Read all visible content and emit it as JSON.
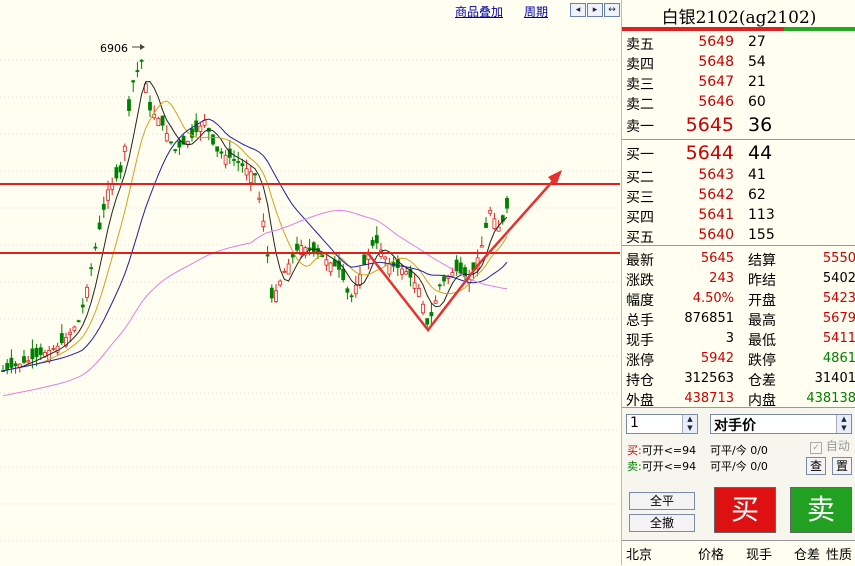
{
  "toolbar": {
    "overlay_label": "商品叠加",
    "period_label": "周期"
  },
  "chart": {
    "peak_label": "6906",
    "colors": {
      "hline": "#e02020",
      "arrow": "#e83030",
      "ma5": "#222",
      "ma10": "#d4a020",
      "ma20": "#2020a0",
      "ma60": "#e080e0",
      "up": "#e02020",
      "down": "#008000"
    }
  },
  "quote": {
    "title": "白银2102(ag2102)",
    "asks": [
      {
        "label": "卖五",
        "price": "5649",
        "vol": "27"
      },
      {
        "label": "卖四",
        "price": "5648",
        "vol": "54"
      },
      {
        "label": "卖三",
        "price": "5647",
        "vol": "21"
      },
      {
        "label": "卖二",
        "price": "5646",
        "vol": "60"
      },
      {
        "label": "卖一",
        "price": "5645",
        "vol": "36"
      }
    ],
    "bids": [
      {
        "label": "买一",
        "price": "5644",
        "vol": "44"
      },
      {
        "label": "买二",
        "price": "5643",
        "vol": "41"
      },
      {
        "label": "买三",
        "price": "5642",
        "vol": "62"
      },
      {
        "label": "买四",
        "price": "5641",
        "vol": "113"
      },
      {
        "label": "买五",
        "price": "5640",
        "vol": "155"
      }
    ],
    "stats": [
      {
        "l1": "最新",
        "v1": "5645",
        "c1": "red",
        "l2": "结算",
        "v2": "5550",
        "c2": "red"
      },
      {
        "l1": "涨跌",
        "v1": "243",
        "c1": "red",
        "l2": "昨结",
        "v2": "5402",
        "c2": "black"
      },
      {
        "l1": "幅度",
        "v1": "4.50%",
        "c1": "red",
        "l2": "开盘",
        "v2": "5423",
        "c2": "red"
      },
      {
        "l1": "总手",
        "v1": "876851",
        "c1": "black",
        "l2": "最高",
        "v2": "5679",
        "c2": "red"
      },
      {
        "l1": "现手",
        "v1": "3",
        "c1": "black",
        "l2": "最低",
        "v2": "5411",
        "c2": "red"
      },
      {
        "l1": "涨停",
        "v1": "5942",
        "c1": "red",
        "l2": "跌停",
        "v2": "4861",
        "c2": "green"
      },
      {
        "l1": "持仓",
        "v1": "312563",
        "c1": "black",
        "l2": "仓差",
        "v2": "31401",
        "c2": "black"
      },
      {
        "l1": "外盘",
        "v1": "438713",
        "c1": "red",
        "l2": "内盘",
        "v2": "438138",
        "c2": "green"
      }
    ]
  },
  "order": {
    "qty": "1",
    "price_type": "对手价",
    "auto_label": "自动",
    "buy_prefix": "买:",
    "buy_open": "可开<=94",
    "sell_prefix": "卖:",
    "sell_open": "可开<=94",
    "close_today_1": "可平/今  0/0",
    "close_today_2": "可平/今  0/0",
    "query_label": "查",
    "fill_label": "置",
    "close_all_label": "全平",
    "cancel_all_label": "全撤",
    "buy_label": "买",
    "sell_label": "卖",
    "buy_color": "#dd1111",
    "sell_color": "#22a022"
  },
  "ticks_header": {
    "city": "北京",
    "price": "价格",
    "hand": "现手",
    "oi_diff": "仓差",
    "nature": "性质"
  }
}
